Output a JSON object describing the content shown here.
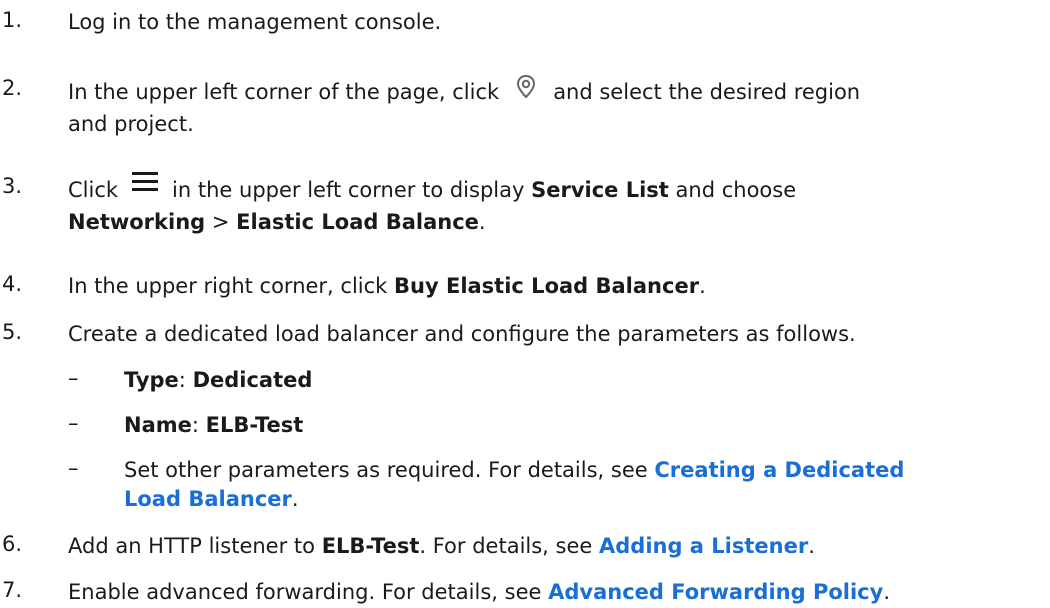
{
  "steps": [
    {
      "num": "1.",
      "text": "Log in to the management console."
    },
    {
      "num": "2.",
      "before": "In the upper left corner of the page, click",
      "after": "and select the desired region",
      "line2": "and project."
    },
    {
      "num": "3.",
      "before": "Click",
      "after": "in the upper left corner to display",
      "bold1": "Service List",
      "mid": "and choose",
      "bold2": "Networking",
      "sep": ">",
      "bold3": "Elastic Load Balance",
      "end": "."
    },
    {
      "num": "4.",
      "before": "In the upper right corner, click",
      "bold": "Buy Elastic Load Balancer",
      "end": "."
    },
    {
      "num": "5.",
      "text": "Create a dedicated load balancer and configure the parameters as follows."
    },
    {
      "num": "6.",
      "before": "Add an HTTP listener to",
      "bold": "ELB-Test",
      "mid": ". For details, see",
      "link": "Adding a Listener",
      "end": "."
    },
    {
      "num": "7.",
      "before": "Enable advanced forwarding. For details, see",
      "link": "Advanced Forwarding Policy",
      "end": "."
    }
  ],
  "substeps": [
    {
      "dash": "–",
      "label": "Type",
      "colon": ":",
      "value": "Dedicated"
    },
    {
      "dash": "–",
      "label": "Name",
      "colon": ":",
      "value": "ELB-Test"
    },
    {
      "dash": "–",
      "before": "Set other parameters as required. For details, see",
      "link1": "Creating a Dedicated",
      "link2": "Load Balancer",
      "end": "."
    }
  ],
  "icons": {
    "pin": "location-pin-icon",
    "menu": "hamburger-menu-icon",
    "pin_color": "#666666",
    "menu_color": "#1a1a1a",
    "link_color": "#1a6ed8"
  }
}
